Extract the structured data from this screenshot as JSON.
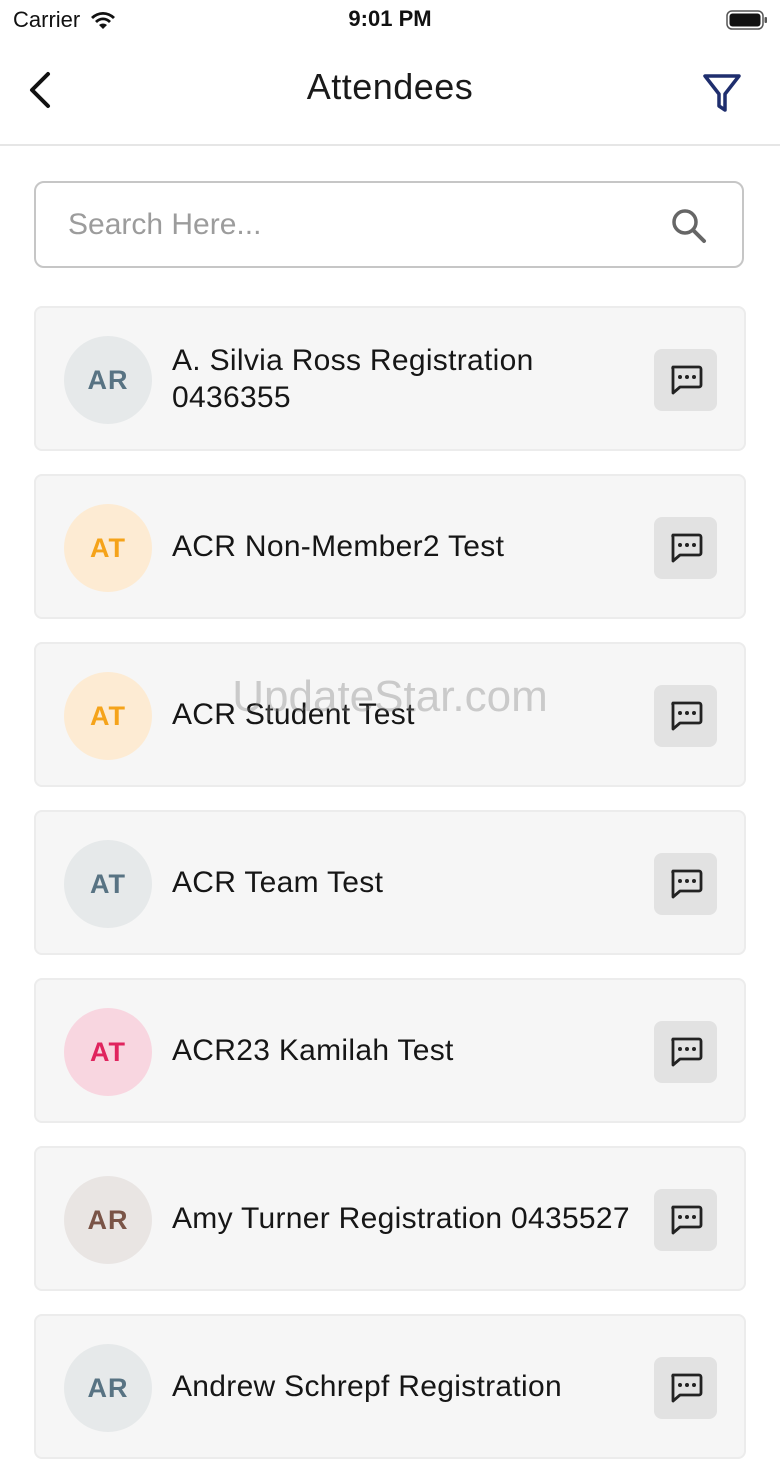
{
  "status_bar": {
    "carrier": "Carrier",
    "time": "9:01 PM"
  },
  "nav": {
    "title": "Attendees",
    "back_icon": "chevron-left-icon",
    "filter_icon": "filter-funnel-icon"
  },
  "search": {
    "placeholder": "Search Here...",
    "value": "",
    "icon": "search-icon"
  },
  "colors": {
    "accent": "#1f2e6e",
    "card_bg": "#f6f6f6",
    "chat_bg": "#e2e2e2"
  },
  "attendees": [
    {
      "initials": "AR",
      "name": "A. Silvia Ross Registration 0436355",
      "avatar_bg": "#e6e9ea",
      "avatar_fg": "#587383"
    },
    {
      "initials": "AT",
      "name": "ACR Non-Member2 Test",
      "avatar_bg": "#fdebd3",
      "avatar_fg": "#f5a31a"
    },
    {
      "initials": "AT",
      "name": "ACR Student Test",
      "avatar_bg": "#fdebd3",
      "avatar_fg": "#f5a31a"
    },
    {
      "initials": "AT",
      "name": "ACR Team Test",
      "avatar_bg": "#e6e9ea",
      "avatar_fg": "#587383"
    },
    {
      "initials": "AT",
      "name": "ACR23 Kamilah Test",
      "avatar_bg": "#f8d6e0",
      "avatar_fg": "#e0245e"
    },
    {
      "initials": "AR",
      "name": "Amy Turner Registration 0435527",
      "avatar_bg": "#e9e5e3",
      "avatar_fg": "#7a5447"
    },
    {
      "initials": "AR",
      "name": "Andrew Schrepf Registration",
      "avatar_bg": "#e6e9ea",
      "avatar_fg": "#587383"
    }
  ],
  "chat_icon": "chat-bubble-icon",
  "watermark": "UpdateStar.com"
}
